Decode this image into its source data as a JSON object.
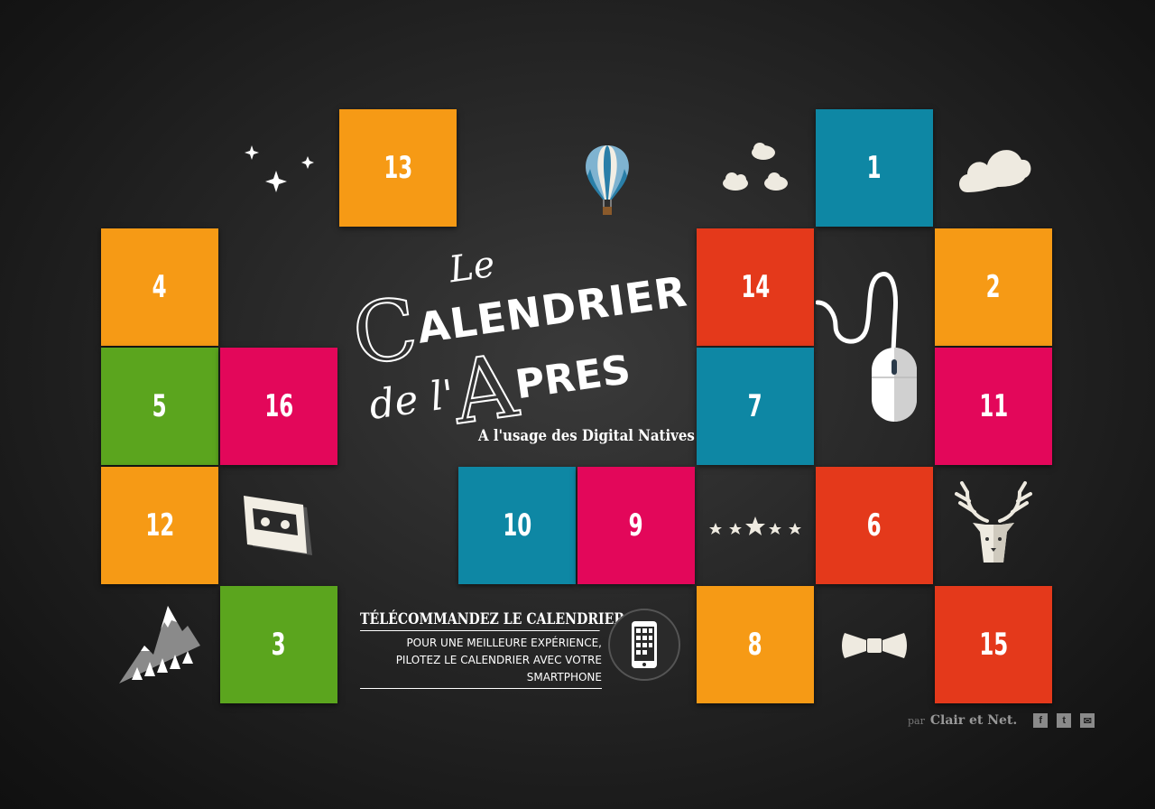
{
  "colors": {
    "orange": "#F69A15",
    "teal": "#0E87A4",
    "red": "#E4391B",
    "pink": "#E3075A",
    "green": "#5BA51E"
  },
  "tiles": [
    {
      "number": "13",
      "color": "orange"
    },
    {
      "number": "1",
      "color": "teal"
    },
    {
      "number": "4",
      "color": "orange"
    },
    {
      "number": "14",
      "color": "red"
    },
    {
      "number": "2",
      "color": "orange"
    },
    {
      "number": "5",
      "color": "green"
    },
    {
      "number": "16",
      "color": "pink"
    },
    {
      "number": "7",
      "color": "teal"
    },
    {
      "number": "11",
      "color": "pink"
    },
    {
      "number": "12",
      "color": "orange"
    },
    {
      "number": "10",
      "color": "teal"
    },
    {
      "number": "9",
      "color": "pink"
    },
    {
      "number": "6",
      "color": "red"
    },
    {
      "number": "3",
      "color": "green"
    },
    {
      "number": "8",
      "color": "orange"
    },
    {
      "number": "15",
      "color": "red"
    }
  ],
  "title": {
    "le": "Le",
    "calendrier_initial": "C",
    "calendrier_rest": "ALENDRIER",
    "de_l": "de l'",
    "apres_initial": "A",
    "apres_rest": "PRES",
    "subtitle": "A l'usage des Digital Natives"
  },
  "remote": {
    "title": "TÉLÉCOMMANDEZ LE CALENDRIER",
    "line1": "POUR UNE MEILLEURE EXPÉRIENCE,",
    "line2": "PILOTEZ LE CALENDRIER AVEC VOTRE SMARTPHONE"
  },
  "footer": {
    "par": "par",
    "brand": "Clair et Net.",
    "facebook": "f",
    "twitter": "t",
    "mail": "✉"
  },
  "icons": [
    "sparkles-icon",
    "hot-air-balloon-icon",
    "small-clouds-icon",
    "cloud-icon",
    "mouse-icon",
    "cassette-icon",
    "stars-rating-icon",
    "deer-icon",
    "mountains-icon",
    "bow-tie-icon",
    "smartphone-icon"
  ]
}
